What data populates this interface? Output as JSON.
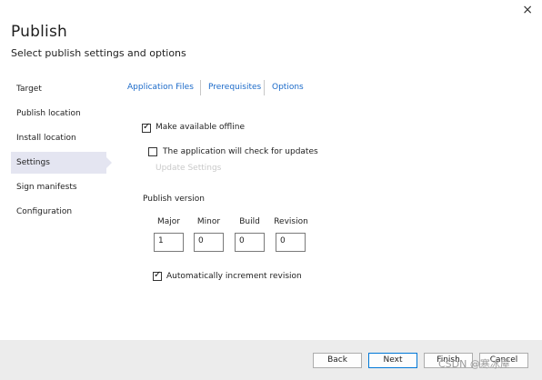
{
  "dialog": {
    "title": "Publish",
    "subtitle": "Select publish settings and options",
    "close_glyph": "×"
  },
  "sidebar": {
    "items": [
      {
        "label": "Target"
      },
      {
        "label": "Publish location"
      },
      {
        "label": "Install location"
      },
      {
        "label": "Settings",
        "active": true
      },
      {
        "label": "Sign manifests"
      },
      {
        "label": "Configuration"
      }
    ]
  },
  "tabs": [
    {
      "label": "Application Files"
    },
    {
      "label": "Prerequisites"
    },
    {
      "label": "Options"
    }
  ],
  "settings": {
    "offline_label": "Make available offline",
    "offline_checked": true,
    "updates_label": "The application will check for updates",
    "updates_checked": false,
    "update_settings_label": "Update Settings",
    "publish_version_label": "Publish version",
    "version": {
      "major_label": "Major",
      "major": "1",
      "minor_label": "Minor",
      "minor": "0",
      "build_label": "Build",
      "build": "0",
      "revision_label": "Revision",
      "revision": "0"
    },
    "auto_increment_label": "Automatically increment revision",
    "auto_increment_checked": true
  },
  "footer": {
    "back": "Back",
    "next": "Next",
    "finish": "Finish",
    "cancel": "Cancel"
  },
  "watermark": "CSDN @寒冰屋",
  "colors": {
    "link": "#1b6ac9",
    "active_item": "#e4e5f1",
    "footer_bg": "#ececec",
    "primary_border": "#0078d7"
  }
}
